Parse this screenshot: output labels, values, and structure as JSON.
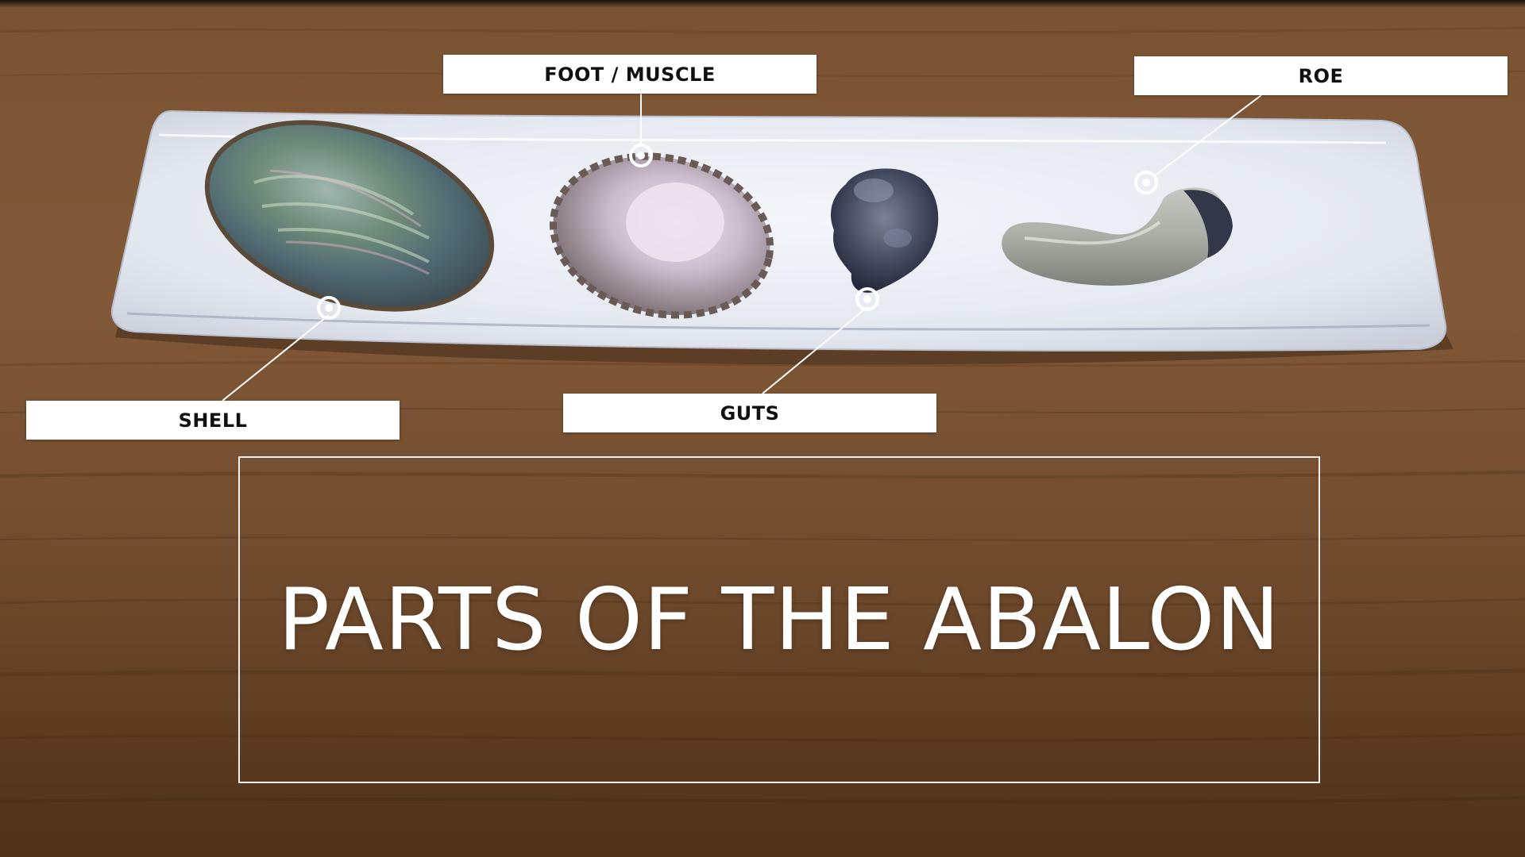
{
  "labels": {
    "foot": "FOOT / MUSCLE",
    "roe": "ROE",
    "shell": "SHELL",
    "guts": "GUTS"
  },
  "title": "PARTS OF THE ABALON",
  "colors": {
    "wood": "#8a5c36",
    "plate": "#e8ecf3",
    "label_bg": "#ffffff",
    "label_text": "#111111",
    "title_text": "#ffffff"
  }
}
